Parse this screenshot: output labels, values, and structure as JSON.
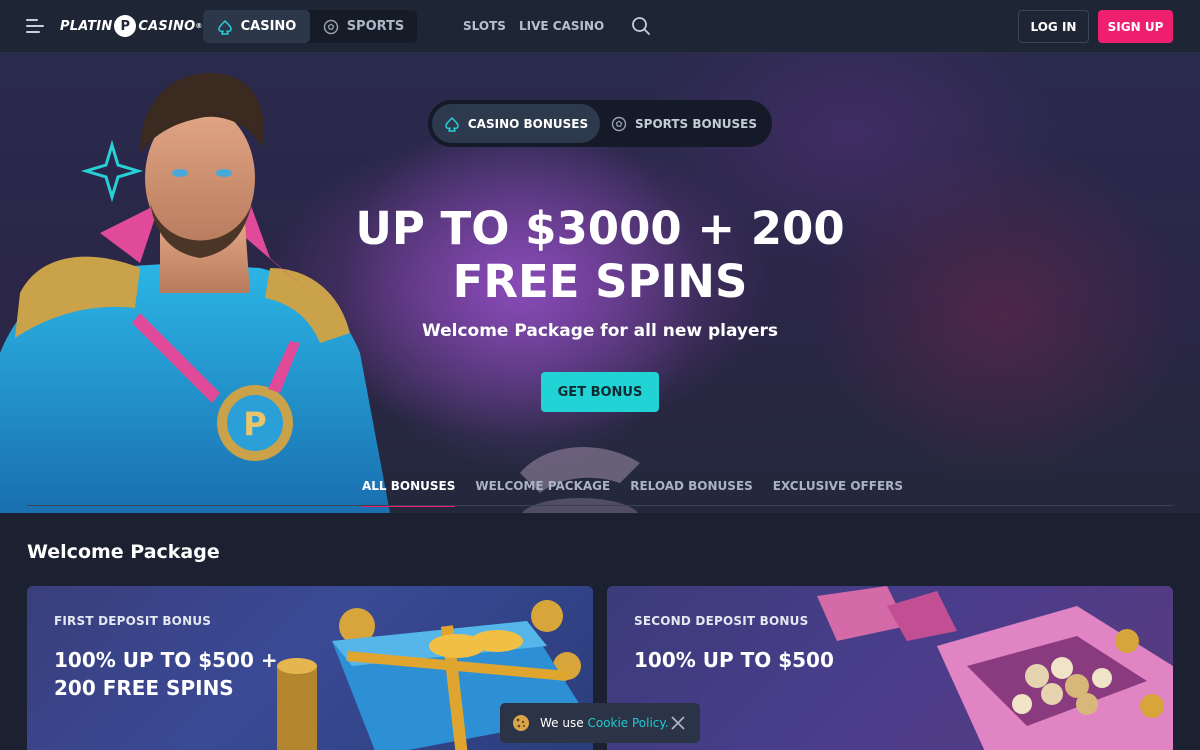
{
  "header": {
    "logo_text_left": "PLATIN",
    "logo_badge": "P",
    "logo_text_right": "CASINO",
    "logo_mark": "®",
    "segments": [
      {
        "label": "CASINO",
        "icon": "spade-icon",
        "active": true
      },
      {
        "label": "SPORTS",
        "icon": "soccer-ball-icon",
        "active": false
      }
    ],
    "nav": [
      "SLOTS",
      "LIVE CASINO"
    ],
    "login_label": "LOG IN",
    "signup_label": "SIGN UP"
  },
  "hero": {
    "toggle": [
      {
        "label": "CASINO BONUSES",
        "icon": "spade-icon",
        "active": true
      },
      {
        "label": "SPORTS BONUSES",
        "icon": "soccer-ball-icon",
        "active": false
      }
    ],
    "title": "UP TO $3000 + 200 FREE SPINS",
    "subtitle": "Welcome Package for all new players",
    "cta_label": "GET BONUS"
  },
  "filter_tabs": [
    {
      "label": "ALL BONUSES",
      "active": true
    },
    {
      "label": "WELCOME PACKAGE",
      "active": false
    },
    {
      "label": "RELOAD BONUSES",
      "active": false
    },
    {
      "label": "EXCLUSIVE OFFERS",
      "active": false
    }
  ],
  "section": {
    "title": "Welcome Package",
    "cards": [
      {
        "kicker": "FIRST DEPOSIT BONUS",
        "title": "100% UP TO $500 + 200 FREE SPINS"
      },
      {
        "kicker": "SECOND DEPOSIT BONUS",
        "title": "100% UP TO $500"
      }
    ]
  },
  "cookie": {
    "text": "We use",
    "link": "Cookie Policy."
  },
  "colors": {
    "accent_pink": "#ee1f6e",
    "accent_cyan": "#22d3d6",
    "header_bg": "#1e2636"
  }
}
